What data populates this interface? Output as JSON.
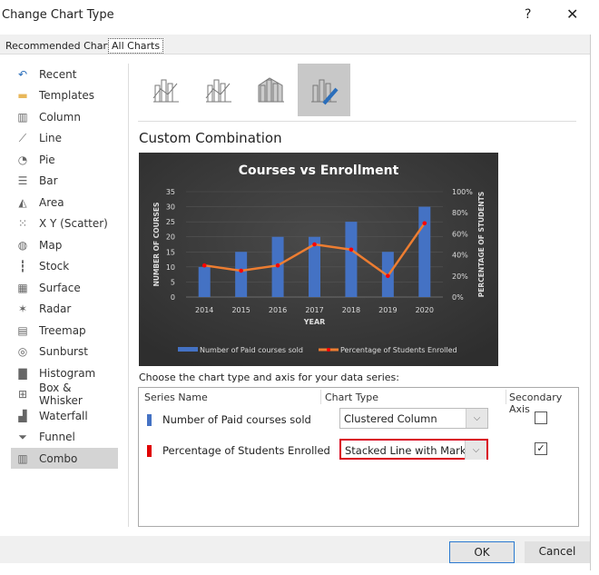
{
  "dialog": {
    "title": "Change Chart Type",
    "help": "?",
    "close": "✕"
  },
  "tabs": [
    {
      "label": "Recommended Charts"
    },
    {
      "label": "All Charts",
      "selected": true
    }
  ],
  "sidebar": {
    "items": [
      {
        "label": "Recent",
        "icon": "undo-icon"
      },
      {
        "label": "Templates",
        "icon": "folder-icon"
      },
      {
        "label": "Column",
        "icon": "column-chart-icon"
      },
      {
        "label": "Line",
        "icon": "line-chart-icon"
      },
      {
        "label": "Pie",
        "icon": "pie-chart-icon"
      },
      {
        "label": "Bar",
        "icon": "bar-chart-icon"
      },
      {
        "label": "Area",
        "icon": "area-chart-icon"
      },
      {
        "label": "X Y (Scatter)",
        "icon": "scatter-chart-icon"
      },
      {
        "label": "Map",
        "icon": "map-icon"
      },
      {
        "label": "Stock",
        "icon": "stock-chart-icon"
      },
      {
        "label": "Surface",
        "icon": "surface-chart-icon"
      },
      {
        "label": "Radar",
        "icon": "radar-chart-icon"
      },
      {
        "label": "Treemap",
        "icon": "treemap-icon"
      },
      {
        "label": "Sunburst",
        "icon": "sunburst-icon"
      },
      {
        "label": "Histogram",
        "icon": "histogram-icon"
      },
      {
        "label": "Box & Whisker",
        "icon": "box-whisker-icon"
      },
      {
        "label": "Waterfall",
        "icon": "waterfall-icon"
      },
      {
        "label": "Funnel",
        "icon": "funnel-icon"
      },
      {
        "label": "Combo",
        "icon": "combo-chart-icon",
        "selected": true
      }
    ]
  },
  "subtypes": [
    {
      "icon": "clustered-column-line-icon"
    },
    {
      "icon": "clustered-column-line-secondary-icon"
    },
    {
      "icon": "stacked-area-column-icon"
    },
    {
      "icon": "custom-combination-icon",
      "selected": true
    }
  ],
  "main": {
    "heading": "Custom Combination",
    "choose_label": "Choose the chart type and axis for your data series:",
    "headers": {
      "series": "Series Name",
      "type": "Chart Type",
      "secondary": "Secondary Axis"
    },
    "rows": [
      {
        "name": "Number of Paid courses sold",
        "color": "#4472c4",
        "type": "Clustered Column",
        "secondary": false
      },
      {
        "name": "Percentage of Students Enrolled",
        "color": "#e00000",
        "type": "Stacked Line with Markers",
        "secondary": true,
        "highlighted": true
      }
    ]
  },
  "buttons": {
    "ok": "OK",
    "cancel": "Cancel"
  },
  "chart_data": {
    "type": "bar+line",
    "title": "Courses vs Enrollment",
    "xlabel": "YEAR",
    "ylabel": "NUMBER OF COURSES",
    "y2label": "PERCENTAGE OF STUDENTS",
    "categories": [
      "2014",
      "2015",
      "2016",
      "2017",
      "2018",
      "2019",
      "2020"
    ],
    "ylim": [
      0,
      35
    ],
    "yticks": [
      "0",
      "5",
      "10",
      "15",
      "20",
      "25",
      "30",
      "35"
    ],
    "y2lim": [
      0,
      100
    ],
    "y2ticks": [
      "0%",
      "20%",
      "40%",
      "60%",
      "80%",
      "100%"
    ],
    "series": [
      {
        "name": "Number of Paid courses sold",
        "type": "bar",
        "axis": "primary",
        "color": "#4472c4",
        "values": [
          10,
          15,
          20,
          20,
          25,
          15,
          30
        ]
      },
      {
        "name": "Percentage of Students Enrolled",
        "type": "line",
        "axis": "secondary",
        "color": "#ed7d31",
        "marker_color": "#ff0000",
        "values": [
          30,
          25,
          30,
          50,
          45,
          20,
          70
        ]
      }
    ],
    "grid": true,
    "legend": "bottom",
    "background": "#3b3b3b"
  }
}
